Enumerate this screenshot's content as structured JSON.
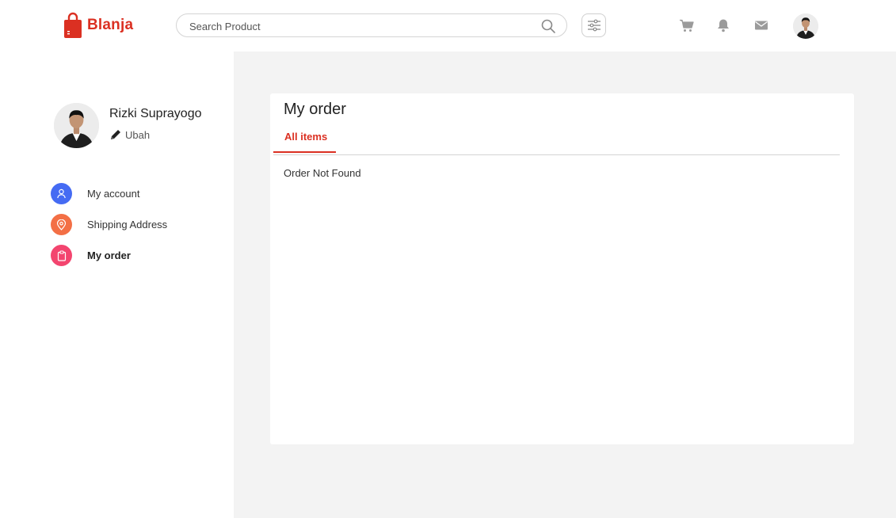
{
  "brand": {
    "name": "Blanja",
    "color": "#DB3022"
  },
  "search": {
    "placeholder": "Search Product",
    "icon": "search-icon"
  },
  "nav_icons": [
    "filter-icon",
    "cart-icon",
    "bell-icon",
    "mail-icon"
  ],
  "user": {
    "name": "Rizki Suprayogo",
    "edit_label": "Ubah"
  },
  "sidebar": {
    "items": [
      {
        "label": "My account",
        "icon": "user-icon",
        "color": "#456BF3"
      },
      {
        "label": "Shipping Address",
        "icon": "map-pin-icon",
        "color": "#F36F45"
      },
      {
        "label": "My order",
        "icon": "clipboard-icon",
        "color": "#F3456F",
        "active": true
      }
    ]
  },
  "main": {
    "title": "My order",
    "tabs": [
      {
        "label": "All items",
        "active": true
      }
    ],
    "empty_message": "Order Not Found"
  },
  "colors": {
    "accent": "#DB3022",
    "main_bg": "#F3F3F3"
  }
}
